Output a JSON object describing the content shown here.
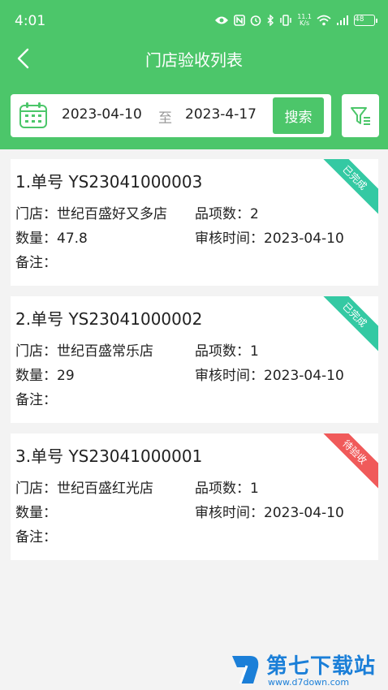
{
  "status": {
    "time": "4:01",
    "speed_top": "11.1",
    "speed_bottom": "K/s",
    "battery": "48"
  },
  "header": {
    "title": "门店验收列表"
  },
  "search": {
    "start_date": "2023-04-10",
    "separator": "至",
    "end_date": "2023-4-17",
    "button_label": "搜索"
  },
  "labels": {
    "store": "门店：",
    "items": "品项数：",
    "qty": "数量：",
    "audit_time": "审核时间：",
    "remark": "备注："
  },
  "orders": [
    {
      "title": "1.单号 YS23041000003",
      "store": "世纪百盛好又多店",
      "items": "2",
      "qty": "47.8",
      "audit_time": "2023-04-10",
      "remark": "",
      "status": "已完成",
      "status_color": "#34c9a3"
    },
    {
      "title": "2.单号 YS23041000002",
      "store": "世纪百盛常乐店",
      "items": "1",
      "qty": "29",
      "audit_time": "2023-04-10",
      "remark": "",
      "status": "已完成",
      "status_color": "#34c9a3"
    },
    {
      "title": "3.单号 YS23041000001",
      "store": "世纪百盛红光店",
      "items": "1",
      "qty": "",
      "audit_time": "2023-04-10",
      "remark": "",
      "status": "待验收",
      "status_color": "#f05a5a"
    }
  ],
  "watermark": {
    "brand": "第七下载站",
    "url": "www.d7down.com"
  },
  "colors": {
    "primary": "#4cc66a",
    "background": "#f3f3f3"
  }
}
